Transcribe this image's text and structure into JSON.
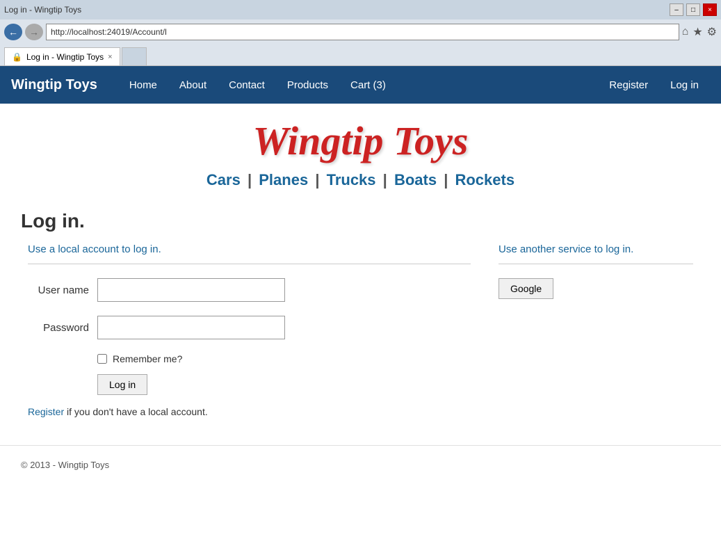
{
  "browser": {
    "title_bar_title": "Log in - Wingtip Toys",
    "address": "http://localhost:24019/Account/l",
    "tab_label": "Log in - Wingtip Toys",
    "tab_close": "×",
    "back_icon": "←",
    "fwd_icon": "→",
    "minimize_icon": "–",
    "maximize_icon": "□",
    "close_icon": "×",
    "home_icon": "⌂",
    "star_icon": "★",
    "gear_icon": "⚙"
  },
  "nav": {
    "brand": "Wingtip Toys",
    "links": [
      {
        "label": "Home",
        "name": "nav-home"
      },
      {
        "label": "About",
        "name": "nav-about"
      },
      {
        "label": "Contact",
        "name": "nav-contact"
      },
      {
        "label": "Products",
        "name": "nav-products"
      },
      {
        "label": "Cart (3)",
        "name": "nav-cart"
      }
    ],
    "right_links": [
      {
        "label": "Register",
        "name": "nav-register"
      },
      {
        "label": "Log in",
        "name": "nav-login"
      }
    ]
  },
  "hero": {
    "title": "Wingtip Toys",
    "categories": [
      {
        "label": "Cars",
        "name": "cat-cars"
      },
      {
        "label": "Planes",
        "name": "cat-planes"
      },
      {
        "label": "Trucks",
        "name": "cat-trucks"
      },
      {
        "label": "Boats",
        "name": "cat-boats"
      },
      {
        "label": "Rockets",
        "name": "cat-rockets"
      }
    ]
  },
  "login_form": {
    "heading": "Log in.",
    "local_subtitle": "Use a local account to log in.",
    "username_label": "User name",
    "password_label": "Password",
    "remember_label": "Remember me?",
    "login_button": "Log in",
    "register_text": " if you don't have a local account.",
    "register_link": "Register"
  },
  "external_login": {
    "subtitle": "Use another service to log in.",
    "google_button": "Google"
  },
  "footer": {
    "text": "© 2013 - Wingtip Toys"
  }
}
